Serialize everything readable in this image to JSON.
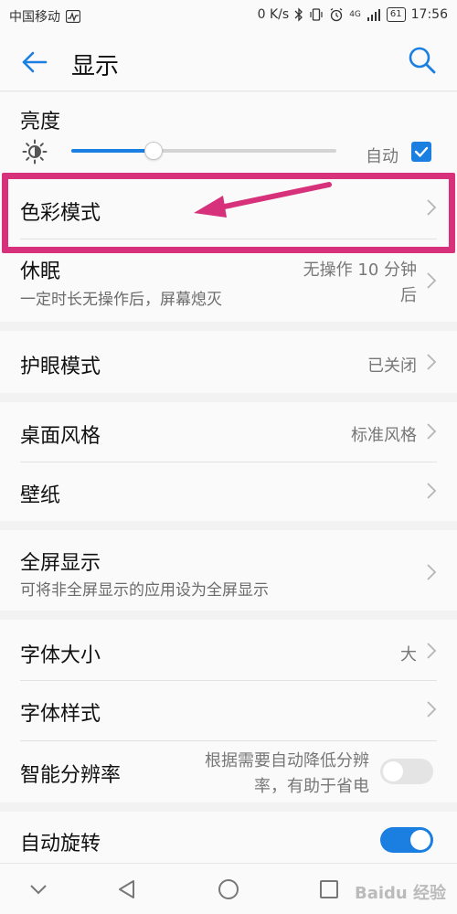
{
  "status_bar": {
    "carrier": "中国移动",
    "speed": "0 K/s",
    "battery": "61",
    "time": "17:56",
    "network": "4G",
    "icons": [
      "activity-icon",
      "bluetooth-icon",
      "vibrate-icon",
      "alarm-icon",
      "signal-icon"
    ]
  },
  "header": {
    "title": "显示",
    "back_icon": "back-arrow-icon",
    "search_icon": "search-icon"
  },
  "brightness": {
    "title": "亮度",
    "level": 0.31,
    "auto_label": "自动",
    "auto_checked": true
  },
  "settings": {
    "color_mode": {
      "title": "色彩模式"
    },
    "sleep": {
      "title": "休眠",
      "subtitle": "一定时长无操作后，屏幕熄灭",
      "value_line1": "无操作 10 分钟",
      "value_line2": "后"
    },
    "eye_comfort": {
      "title": "护眼模式",
      "value": "已关闭"
    },
    "home_style": {
      "title": "桌面风格",
      "value": "标准风格"
    },
    "wallpaper": {
      "title": "壁纸"
    },
    "full_screen": {
      "title": "全屏显示",
      "subtitle": "可将非全屏显示的应用设为全屏显示"
    },
    "font_size": {
      "title": "字体大小",
      "value": "大"
    },
    "font_style": {
      "title": "字体样式"
    },
    "smart_resolution": {
      "title": "智能分辨率",
      "value_line1": "根据需要自动降低分辨",
      "value_line2": "率，有助于省电",
      "enabled": false
    },
    "auto_rotate": {
      "title": "自动旋转",
      "enabled": true
    }
  },
  "nav": {
    "icons": [
      "nav-down-icon",
      "nav-back-icon",
      "nav-home-icon",
      "nav-recent-icon"
    ],
    "watermark": "Baidu 经验"
  },
  "colors": {
    "accent": "#1a7fe0",
    "highlight": "#d6317a",
    "background": "#f2f2f2",
    "card": "#fafafa"
  }
}
